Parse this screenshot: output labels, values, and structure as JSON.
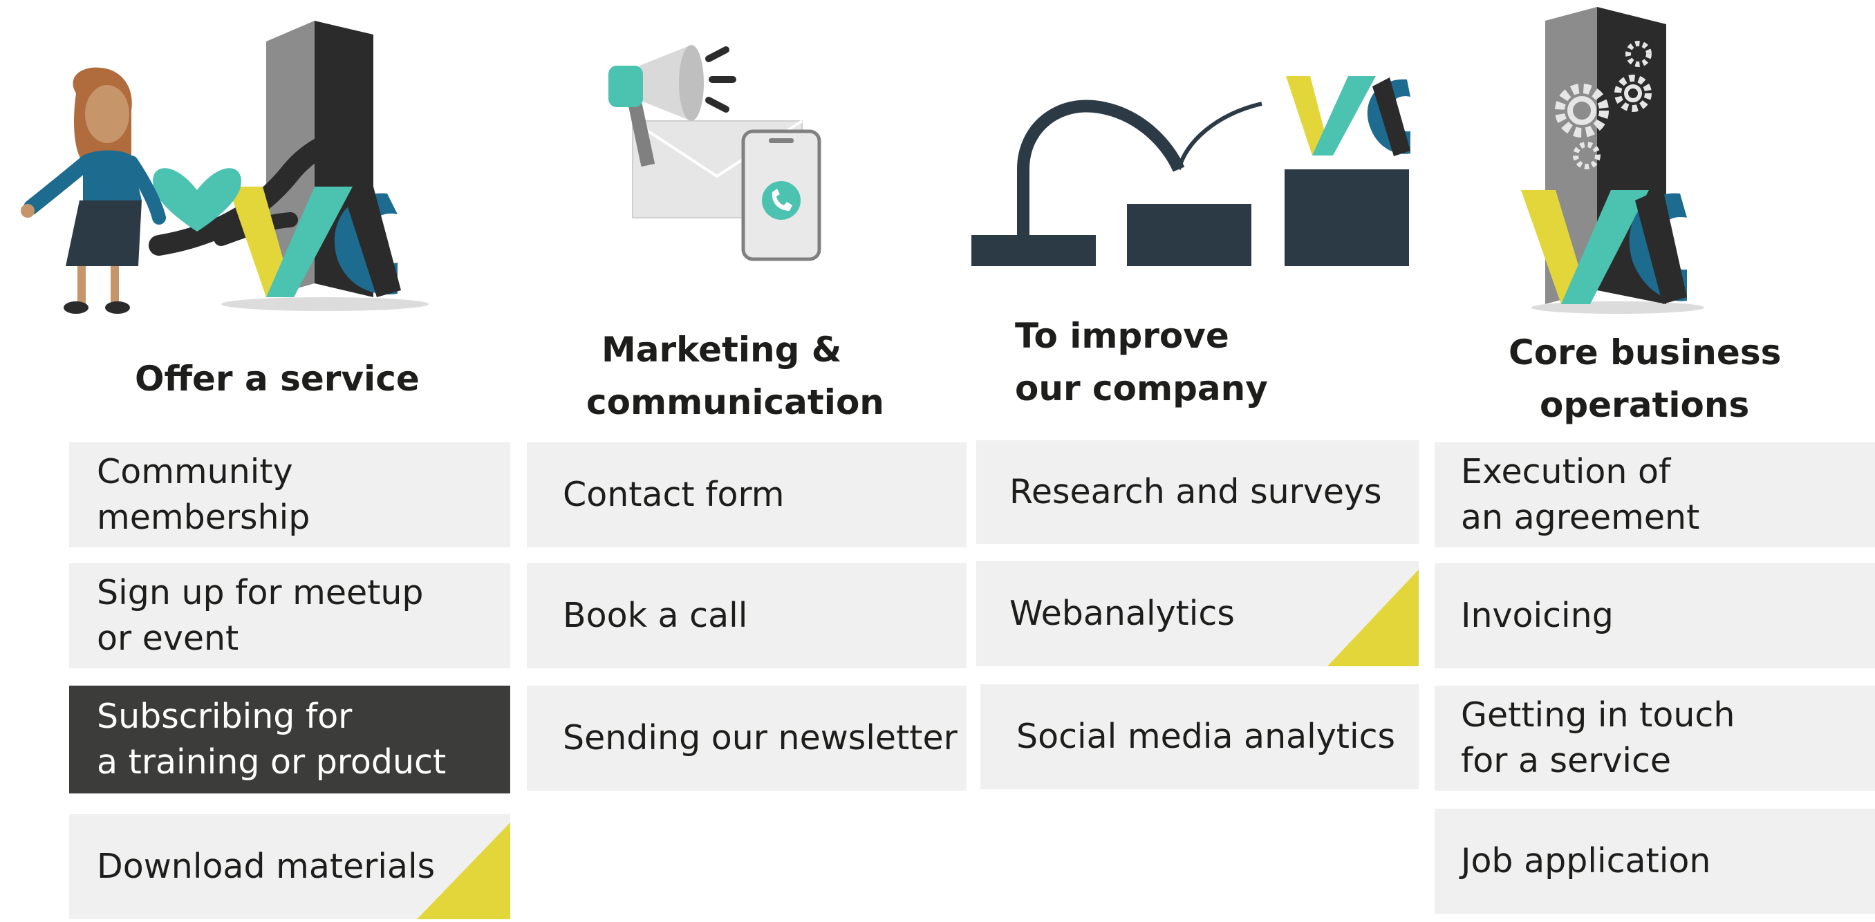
{
  "colors": {
    "box_bg": "#f0f0f0",
    "box_highlight_bg": "#3c3c3b",
    "text": "#1d1d1b",
    "accent_yellow": "#e3d63b",
    "accent_teal": "#4cc2b0",
    "accent_blue": "#1d6b8f",
    "pillar_dark": "#2b2b2b",
    "pillar_grey": "#808080"
  },
  "illustrations": [
    {
      "icon": "woman-giving-heart-to-vc-pillar-icon"
    },
    {
      "icon": "megaphone-envelope-phone-icon"
    },
    {
      "icon": "step-growth-vc-logo-icon"
    },
    {
      "icon": "gears-vc-pillar-icon"
    }
  ],
  "columns": [
    {
      "heading": [
        "Offer a service"
      ],
      "items": [
        {
          "lines": [
            "Community",
            "membership"
          ],
          "highlighted": false,
          "corner_mark": false
        },
        {
          "lines": [
            "Sign up for meetup",
            "or event"
          ],
          "highlighted": false,
          "corner_mark": false
        },
        {
          "lines": [
            "Subscribing for",
            "a training or product"
          ],
          "highlighted": true,
          "corner_mark": false
        },
        {
          "lines": [
            "Download materials"
          ],
          "highlighted": false,
          "corner_mark": true
        }
      ]
    },
    {
      "heading": [
        "Marketing &",
        "communication"
      ],
      "items": [
        {
          "lines": [
            "Contact form"
          ],
          "highlighted": false,
          "corner_mark": false
        },
        {
          "lines": [
            "Book a call"
          ],
          "highlighted": false,
          "corner_mark": false
        },
        {
          "lines": [
            "Sending our newsletter"
          ],
          "highlighted": false,
          "corner_mark": false
        }
      ]
    },
    {
      "heading": [
        "To improve",
        "our company"
      ],
      "items": [
        {
          "lines": [
            "Research and surveys"
          ],
          "highlighted": false,
          "corner_mark": false
        },
        {
          "lines": [
            "Webanalytics"
          ],
          "highlighted": false,
          "corner_mark": true
        },
        {
          "lines": [
            "Social media analytics"
          ],
          "highlighted": false,
          "corner_mark": false
        }
      ]
    },
    {
      "heading": [
        "Core business",
        "operations"
      ],
      "items": [
        {
          "lines": [
            "Execution of",
            "an agreement"
          ],
          "highlighted": false,
          "corner_mark": false
        },
        {
          "lines": [
            "Invoicing"
          ],
          "highlighted": false,
          "corner_mark": false
        },
        {
          "lines": [
            "Getting in touch",
            "for a service"
          ],
          "highlighted": false,
          "corner_mark": false
        },
        {
          "lines": [
            "Job application"
          ],
          "highlighted": false,
          "corner_mark": false
        }
      ]
    }
  ]
}
